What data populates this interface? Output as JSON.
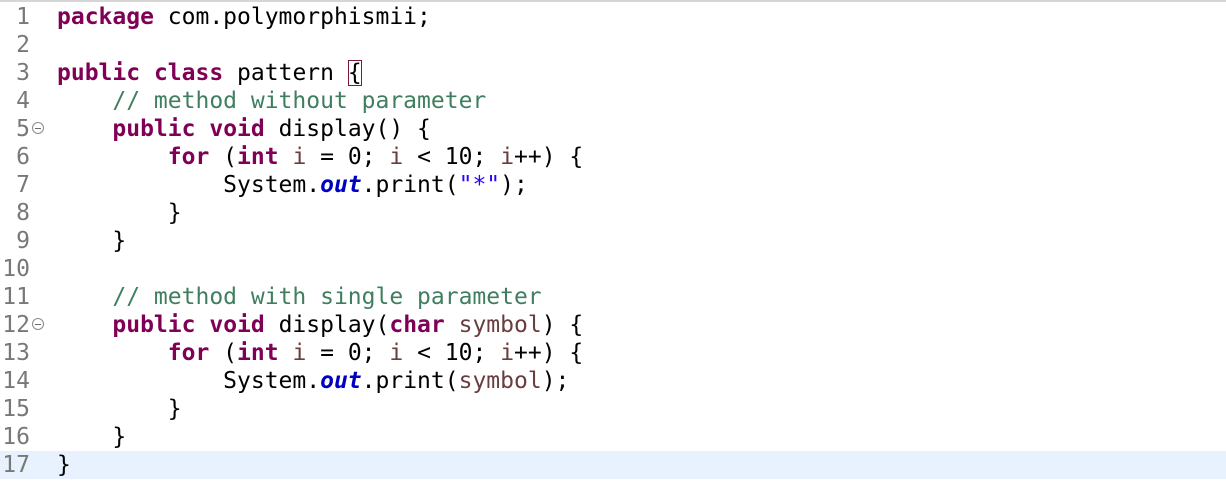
{
  "editor": {
    "language": "Java",
    "current_line": 17,
    "lines": [
      {
        "number": "1",
        "tokens": [
          {
            "t": "package",
            "c": "kw"
          },
          {
            "t": " com.polymorphismii;",
            "c": ""
          }
        ]
      },
      {
        "number": "2",
        "tokens": []
      },
      {
        "number": "3",
        "tokens": [
          {
            "t": "public",
            "c": "kw"
          },
          {
            "t": " ",
            "c": ""
          },
          {
            "t": "class",
            "c": "kw"
          },
          {
            "t": " pattern ",
            "c": ""
          },
          {
            "t": "{",
            "c": "brace-box"
          }
        ]
      },
      {
        "number": "4",
        "tokens": [
          {
            "t": "    ",
            "c": ""
          },
          {
            "t": "// method without parameter",
            "c": "cm"
          }
        ]
      },
      {
        "number": "5",
        "fold": true,
        "tokens": [
          {
            "t": "    ",
            "c": ""
          },
          {
            "t": "public",
            "c": "kw"
          },
          {
            "t": " ",
            "c": ""
          },
          {
            "t": "void",
            "c": "kw"
          },
          {
            "t": " display() {",
            "c": ""
          }
        ]
      },
      {
        "number": "6",
        "tokens": [
          {
            "t": "        ",
            "c": ""
          },
          {
            "t": "for",
            "c": "kw"
          },
          {
            "t": " (",
            "c": ""
          },
          {
            "t": "int",
            "c": "kw"
          },
          {
            "t": " ",
            "c": ""
          },
          {
            "t": "i",
            "c": "var"
          },
          {
            "t": " = 0; ",
            "c": ""
          },
          {
            "t": "i",
            "c": "var"
          },
          {
            "t": " < 10; ",
            "c": ""
          },
          {
            "t": "i",
            "c": "var"
          },
          {
            "t": "++) {",
            "c": ""
          }
        ]
      },
      {
        "number": "7",
        "tokens": [
          {
            "t": "            System.",
            "c": ""
          },
          {
            "t": "out",
            "c": "fld"
          },
          {
            "t": ".print(",
            "c": ""
          },
          {
            "t": "\"*\"",
            "c": "str"
          },
          {
            "t": ");",
            "c": ""
          }
        ]
      },
      {
        "number": "8",
        "tokens": [
          {
            "t": "        }",
            "c": ""
          }
        ]
      },
      {
        "number": "9",
        "tokens": [
          {
            "t": "    }",
            "c": ""
          }
        ]
      },
      {
        "number": "10",
        "tokens": []
      },
      {
        "number": "11",
        "tokens": [
          {
            "t": "    ",
            "c": ""
          },
          {
            "t": "// method with single parameter",
            "c": "cm"
          }
        ]
      },
      {
        "number": "12",
        "fold": true,
        "tokens": [
          {
            "t": "    ",
            "c": ""
          },
          {
            "t": "public",
            "c": "kw"
          },
          {
            "t": " ",
            "c": ""
          },
          {
            "t": "void",
            "c": "kw"
          },
          {
            "t": " display(",
            "c": ""
          },
          {
            "t": "char",
            "c": "kw"
          },
          {
            "t": " ",
            "c": ""
          },
          {
            "t": "symbol",
            "c": "var"
          },
          {
            "t": ") {",
            "c": ""
          }
        ]
      },
      {
        "number": "13",
        "tokens": [
          {
            "t": "        ",
            "c": ""
          },
          {
            "t": "for",
            "c": "kw"
          },
          {
            "t": " (",
            "c": ""
          },
          {
            "t": "int",
            "c": "kw"
          },
          {
            "t": " ",
            "c": ""
          },
          {
            "t": "i",
            "c": "var"
          },
          {
            "t": " = 0; ",
            "c": ""
          },
          {
            "t": "i",
            "c": "var"
          },
          {
            "t": " < 10; ",
            "c": ""
          },
          {
            "t": "i",
            "c": "var"
          },
          {
            "t": "++) {",
            "c": ""
          }
        ]
      },
      {
        "number": "14",
        "tokens": [
          {
            "t": "            System.",
            "c": ""
          },
          {
            "t": "out",
            "c": "fld"
          },
          {
            "t": ".print(",
            "c": ""
          },
          {
            "t": "symbol",
            "c": "var"
          },
          {
            "t": ");",
            "c": ""
          }
        ]
      },
      {
        "number": "15",
        "tokens": [
          {
            "t": "        }",
            "c": ""
          }
        ]
      },
      {
        "number": "16",
        "tokens": [
          {
            "t": "    }",
            "c": ""
          }
        ]
      },
      {
        "number": "17",
        "tokens": [
          {
            "t": "}",
            "c": ""
          }
        ]
      }
    ]
  },
  "colors": {
    "keyword": "#7f0055",
    "comment": "#3f7f5f",
    "variable": "#6a3e3e",
    "field": "#0000c0",
    "string": "#2a00ff",
    "line_number": "#787878",
    "current_line_highlight": "#e8f2fe"
  }
}
